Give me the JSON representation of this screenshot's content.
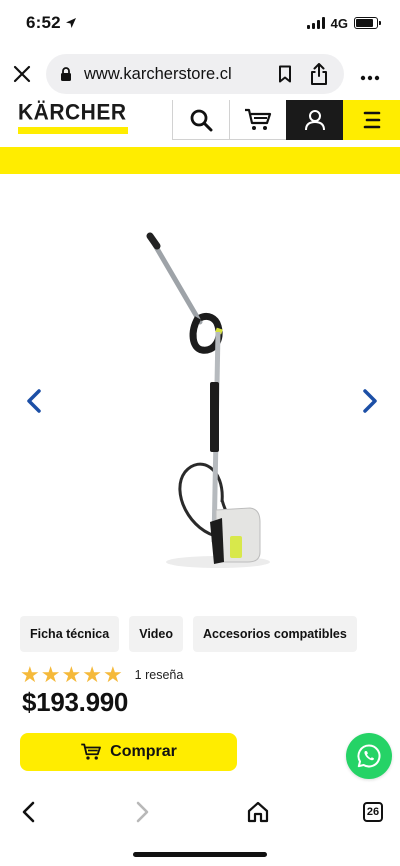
{
  "status_bar": {
    "time": "6:52",
    "network": "4G",
    "battery_level": 0.85
  },
  "browser": {
    "url": "www.karcherstore.cl",
    "tab_count": "26",
    "close_icon": "close-icon",
    "lock_icon": "lock-icon",
    "bookmark_icon": "bookmark-icon",
    "share_icon": "share-icon",
    "more_icon": "more-icon"
  },
  "header": {
    "logo": "KÄRCHER",
    "search_icon": "search-icon",
    "cart_icon": "cart-icon",
    "account_icon": "user-icon",
    "menu_icon": "menu-icon"
  },
  "gallery": {
    "prev_icon": "chevron-left-icon",
    "next_icon": "chevron-right-icon"
  },
  "tabs": [
    {
      "label": "Ficha técnica"
    },
    {
      "label": "Video"
    },
    {
      "label": "Accesorios compatibles"
    }
  ],
  "product": {
    "rating": 5,
    "rating_max": 5,
    "review_count": "1 reseña",
    "price": "$193.990"
  },
  "actions": {
    "buy_label": "Comprar"
  },
  "colors": {
    "brand_yellow": "#ffed00",
    "brand_black": "#1a1a1a",
    "arrow_blue": "#1c4fa6",
    "star": "#f5b93a",
    "whatsapp": "#25d366"
  }
}
